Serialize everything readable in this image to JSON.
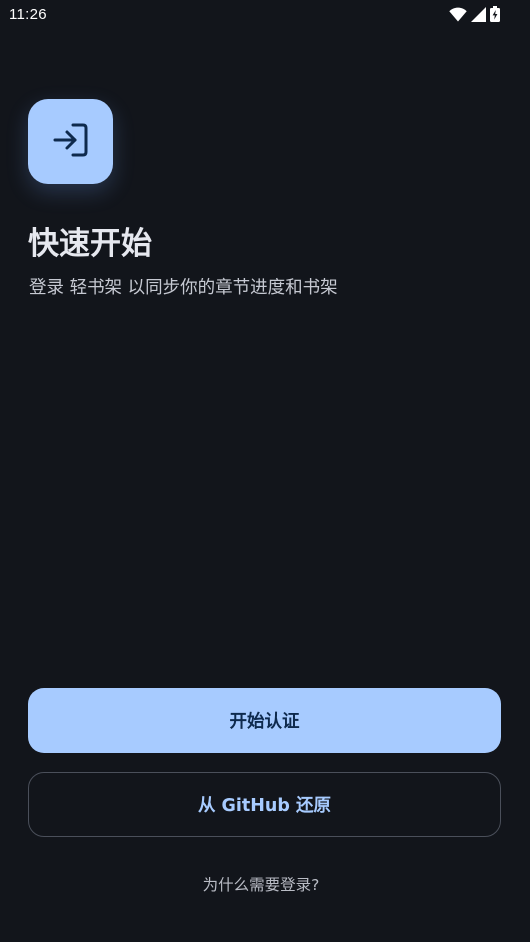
{
  "status_bar": {
    "time": "11:26",
    "icons": [
      "wifi-icon",
      "signal-icon",
      "battery-charging-icon"
    ]
  },
  "app_icon": {
    "name": "login-icon",
    "tile_color": "#a7cbff",
    "glyph_color": "#0e2a4d"
  },
  "header": {
    "title": "快速开始",
    "subtitle": "登录 轻书架 以同步你的章节进度和书架"
  },
  "actions": {
    "primary_label": "开始认证",
    "secondary_label": "从 GitHub 还原",
    "help_link": "为什么需要登录?"
  },
  "colors": {
    "background": "#12151b",
    "accent": "#a7cbff",
    "on_accent": "#0e2a4d",
    "outline": "#4a4f5a"
  }
}
